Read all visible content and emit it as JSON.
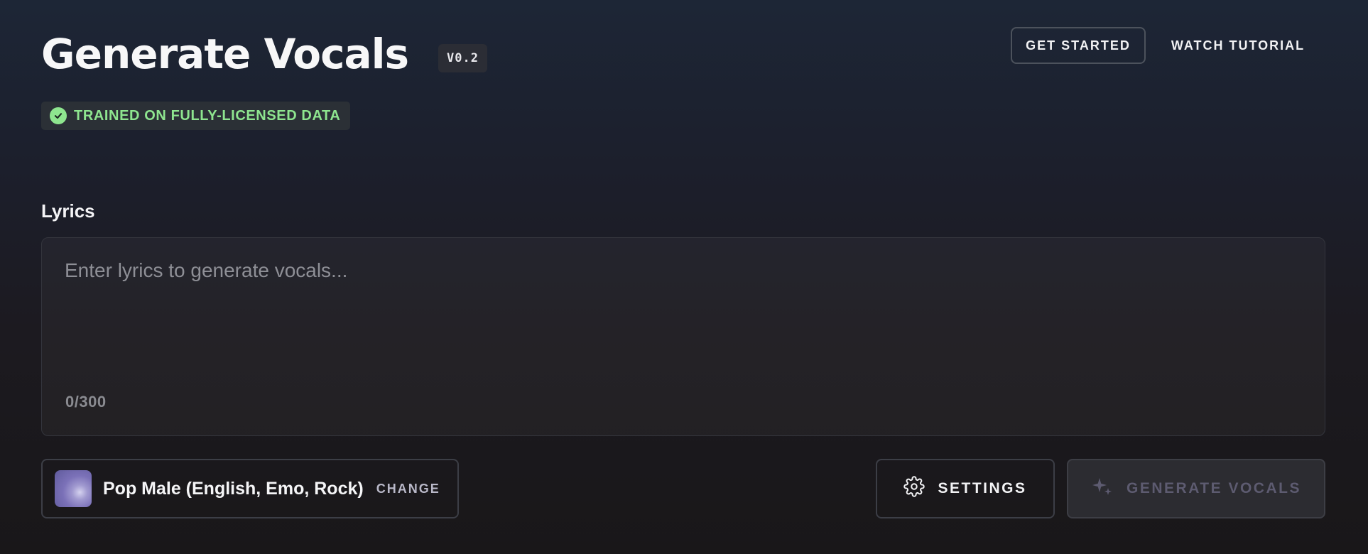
{
  "header": {
    "title": "Generate Vocals",
    "version": "V0.2",
    "licensed_badge": "TRAINED ON FULLY-LICENSED DATA",
    "get_started": "GET STARTED",
    "watch_tutorial": "WATCH TUTORIAL"
  },
  "lyrics": {
    "label": "Lyrics",
    "value": "",
    "placeholder": "Enter lyrics to generate vocals...",
    "counter": "0/300"
  },
  "voice": {
    "name": "Pop Male (English, Emo, Rock)",
    "change_label": "CHANGE"
  },
  "actions": {
    "settings": "SETTINGS",
    "generate": "GENERATE VOCALS"
  },
  "colors": {
    "accent_green": "#8ee58f",
    "disabled_text": "#5d5b70"
  },
  "icons": {
    "badge": "check-circle-icon",
    "settings": "gear-icon",
    "generate": "sparkle-icon"
  }
}
